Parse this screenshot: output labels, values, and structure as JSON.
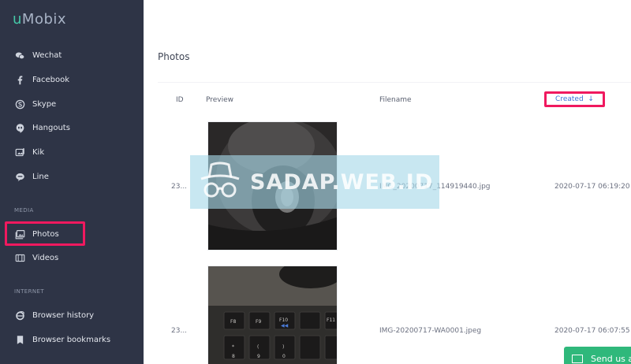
{
  "app": {
    "logo_prefix": "u",
    "logo_rest": "Mobix"
  },
  "sidebar": {
    "items": [
      {
        "label": "Wechat",
        "icon": "wechat-icon"
      },
      {
        "label": "Facebook",
        "icon": "facebook-icon"
      },
      {
        "label": "Skype",
        "icon": "skype-icon"
      },
      {
        "label": "Hangouts",
        "icon": "hangouts-icon"
      },
      {
        "label": "Kik",
        "icon": "kik-icon"
      },
      {
        "label": "Line",
        "icon": "line-icon"
      }
    ],
    "media_label": "MEDIA",
    "media_items": [
      {
        "label": "Photos",
        "icon": "photos-icon"
      },
      {
        "label": "Videos",
        "icon": "videos-icon"
      }
    ],
    "internet_label": "INTERNET",
    "internet_items": [
      {
        "label": "Browser history",
        "icon": "browser-history-icon"
      },
      {
        "label": "Browser bookmarks",
        "icon": "bookmark-icon"
      }
    ]
  },
  "main": {
    "title": "Photos",
    "columns": {
      "id": "ID",
      "preview": "Preview",
      "filename": "Filename",
      "created": "Created",
      "created_sort_icon": "↓"
    },
    "rows": [
      {
        "id": "23...",
        "filename": "IMG_20200717_114919440.jpg",
        "created": "2020-07-17 06:19:20"
      },
      {
        "id": "23...",
        "filename": "IMG-20200717-WA0001.jpeg",
        "created": "2020-07-17 06:07:55"
      }
    ]
  },
  "send_button": {
    "label": "Send us a"
  },
  "watermark": {
    "text": "SADAP.WEB.ID"
  },
  "colors": {
    "sidebar": "#2e3446",
    "highlight": "#f0195f",
    "accent": "#3a6fd8",
    "send": "#2fb87b"
  }
}
